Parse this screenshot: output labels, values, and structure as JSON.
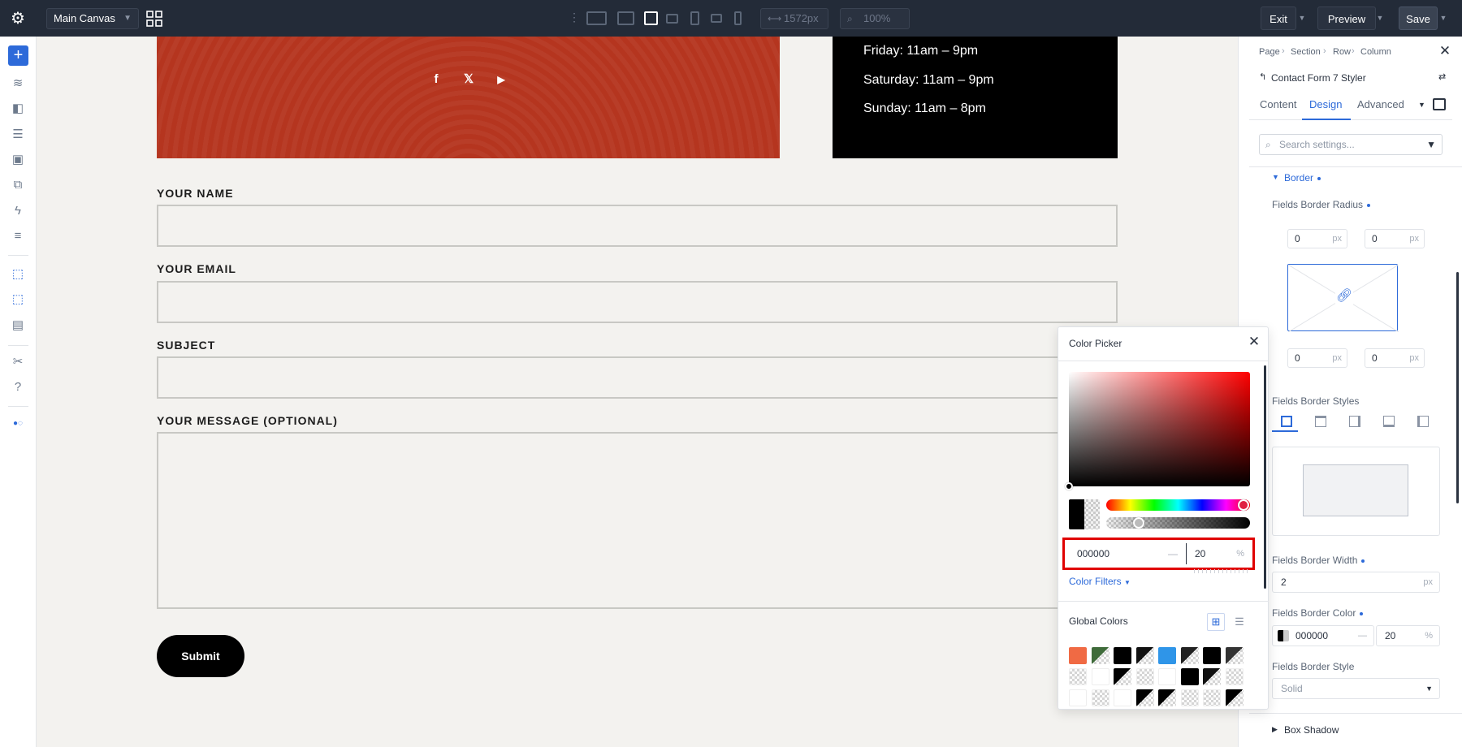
{
  "topbar": {
    "canvas_select": "Main Canvas",
    "width_readout": "1572px",
    "zoom_readout": "100%",
    "exit_label": "Exit",
    "preview_label": "Preview",
    "save_label": "Save"
  },
  "canvas": {
    "hours": [
      "Friday: 11am – 9pm",
      "Saturday: 11am – 9pm",
      "Sunday: 11am – 8pm"
    ],
    "fields": [
      {
        "label": "YOUR NAME"
      },
      {
        "label": "YOUR EMAIL"
      },
      {
        "label": "SUBJECT"
      },
      {
        "label": "YOUR MESSAGE (OPTIONAL)"
      }
    ],
    "submit_label": "Submit"
  },
  "panel": {
    "breadcrumb": [
      "Page",
      "Section",
      "Row",
      "Column"
    ],
    "module_title": "Contact Form 7 Styler",
    "tabs": [
      "Content",
      "Design",
      "Advanced"
    ],
    "active_tab": "Design",
    "search_placeholder": "Search settings...",
    "border_section": "Border",
    "radius_label": "Fields Border Radius",
    "radius_values": [
      "0",
      "0",
      "0",
      "0"
    ],
    "radius_unit": "px",
    "styles_label": "Fields Border Styles",
    "width_label": "Fields Border Width",
    "width_value": "2",
    "width_unit": "px",
    "color_label": "Fields Border Color",
    "color_hex": "000000",
    "color_alpha": "20",
    "color_alpha_unit": "%",
    "style_label": "Fields Border Style",
    "style_value": "Solid",
    "box_shadow_label": "Box Shadow"
  },
  "picker": {
    "title": "Color Picker",
    "hex": "000000",
    "alpha": "20",
    "alpha_unit": "%",
    "color_filters": "Color Filters",
    "global_colors": "Global Colors",
    "hue_color": "#ff0000",
    "opacity_fraction": 0.2
  },
  "colors": {
    "accent": "#2d6ad9",
    "topbar": "#232b38",
    "red_block": "#b5351f",
    "highlight": "#e00000"
  }
}
